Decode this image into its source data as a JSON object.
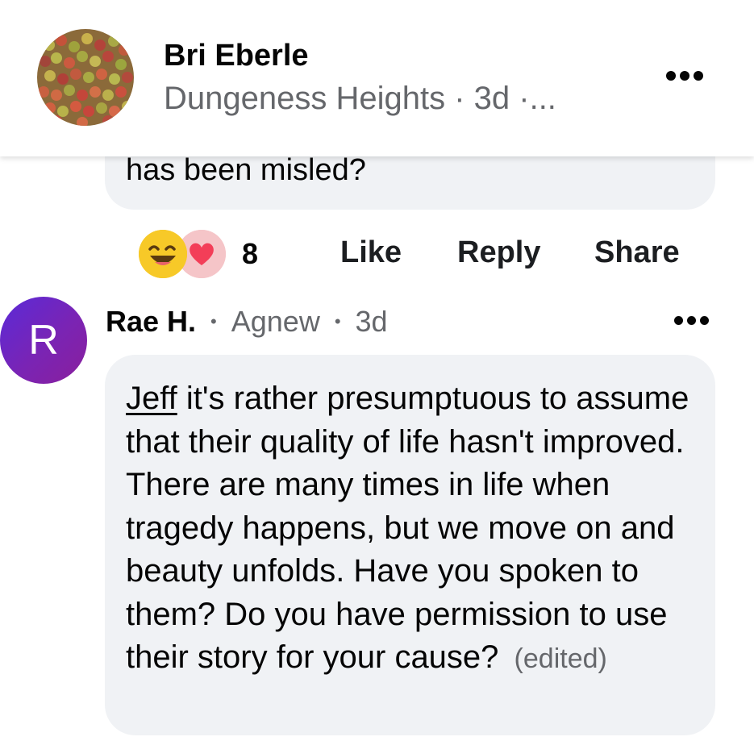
{
  "post_header": {
    "author": "Bri Eberle",
    "meta": "Dungeness Heights · 3d ·...",
    "avatar_icon": "apple-pile-photo",
    "more_icon": "more-dots-icon"
  },
  "previous_comment": {
    "text_tail": "has been misled?",
    "reactions": {
      "icons": [
        "haha-reaction-icon",
        "love-reaction-icon"
      ],
      "count": "8"
    },
    "actions": {
      "like": "Like",
      "reply": "Reply",
      "share": "Share"
    }
  },
  "comment": {
    "avatar_letter": "R",
    "author": "Rae H.",
    "location": "Agnew",
    "time": "3d",
    "mention": "Jeff",
    "text": "it's rather presumptuous to assume that their quality of life hasn't improved. There are many times in life when tragedy happens, but we move on and beauty unfolds. Have you spoken to them? Do you have permission to use their story for your cause?",
    "edited_label": "(edited)"
  },
  "colors": {
    "bubble": "#f0f2f5",
    "secondary_text": "#65676b",
    "avatar_gradient_start": "#5a2ad8",
    "avatar_gradient_end": "#8a1f9c",
    "haha": "#f7c928",
    "love": "#f33e58"
  }
}
